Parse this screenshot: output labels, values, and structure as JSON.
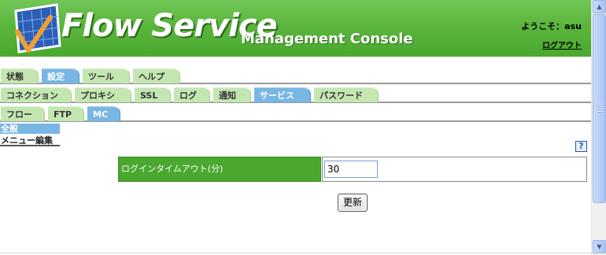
{
  "header": {
    "brand": "Flow Service",
    "subbrand": "Management Console",
    "welcome": "ようこそ：asu",
    "logout": "ログアウト",
    "logo_icon": "flow-service-logo-icon"
  },
  "tabs": {
    "row1": [
      {
        "label": "状態"
      },
      {
        "label": "設定"
      },
      {
        "label": "ツール"
      },
      {
        "label": "ヘルプ"
      }
    ],
    "row2": [
      {
        "label": "コネクション"
      },
      {
        "label": "プロキシ"
      },
      {
        "label": "SSL"
      },
      {
        "label": "ログ"
      },
      {
        "label": "通知"
      },
      {
        "label": "サービス"
      },
      {
        "label": "パスワード"
      }
    ],
    "row3": [
      {
        "label": "フロー"
      },
      {
        "label": "FTP"
      },
      {
        "label": "MC"
      }
    ]
  },
  "sidebar": {
    "items": [
      {
        "label": "全般"
      },
      {
        "label": "メニュー編集"
      }
    ]
  },
  "help": {
    "label": "?"
  },
  "form": {
    "timeout_label": "ログインタイムアウト(分)",
    "timeout_value": "30",
    "update_button": "更新"
  },
  "scrollbar": {
    "up": "▲",
    "down": "▼"
  },
  "colors": {
    "header_green": "#5bb53d",
    "tab_green": "#c4e7b2",
    "tab_active_blue": "#78b6e4",
    "label_green": "#4aa82e"
  }
}
